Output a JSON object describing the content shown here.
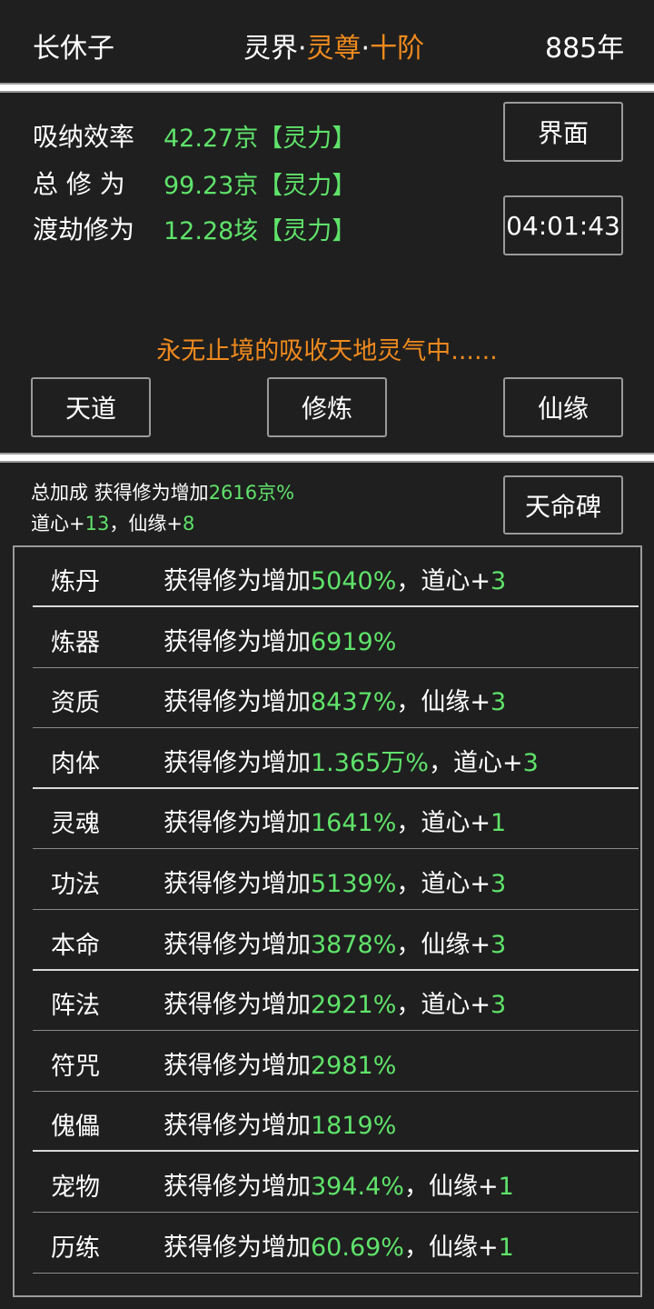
{
  "header": {
    "player_name": "长休子",
    "realm_prefix": "灵界",
    "separator": "·",
    "realm_rank": "灵尊",
    "realm_stage": "十阶",
    "year": "885年"
  },
  "stats": [
    {
      "label": "吸纳效率",
      "value": "42.27京【灵力】"
    },
    {
      "label": "总 修 为",
      "value": "99.23京【灵力】"
    },
    {
      "label": "渡劫修为",
      "value": "12.28垓【灵力】"
    }
  ],
  "buttons": {
    "interface": "界面",
    "timer": "04:01:43",
    "tiandao": "天道",
    "xiulian": "修炼",
    "xianyuan": "仙缘",
    "tianmingbei": "天命碑"
  },
  "status_message": "永无止境的吸收天地灵气中......",
  "bonus": {
    "line1_prefix": "总加成 获得修为增加",
    "line1_value": "2616京%",
    "line2_daoxin_label": "道心+",
    "line2_daoxin_value": "13",
    "line2_sep": "，仙缘+",
    "line2_xianyuan_value": "8"
  },
  "rows": [
    {
      "name": "炼丹",
      "prefix": "获得修为增加",
      "value": "5040%",
      "extra_label": "，道心+",
      "extra_value": "3"
    },
    {
      "name": "炼器",
      "prefix": "获得修为增加",
      "value": "6919%",
      "extra_label": "",
      "extra_value": ""
    },
    {
      "name": "资质",
      "prefix": "获得修为增加",
      "value": "8437%",
      "extra_label": "，仙缘+",
      "extra_value": "3"
    },
    {
      "name": "肉体",
      "prefix": "获得修为增加",
      "value": "1.365万%",
      "extra_label": "，道心+",
      "extra_value": "3"
    },
    {
      "name": "灵魂",
      "prefix": "获得修为增加",
      "value": "1641%",
      "extra_label": "，道心+",
      "extra_value": "1"
    },
    {
      "name": "功法",
      "prefix": "获得修为增加",
      "value": "5139%",
      "extra_label": "，道心+",
      "extra_value": "3"
    },
    {
      "name": "本命",
      "prefix": "获得修为增加",
      "value": "3878%",
      "extra_label": "，仙缘+",
      "extra_value": "3"
    },
    {
      "name": "阵法",
      "prefix": "获得修为增加",
      "value": "2921%",
      "extra_label": "，道心+",
      "extra_value": "3"
    },
    {
      "name": "符咒",
      "prefix": "获得修为增加",
      "value": "2981%",
      "extra_label": "",
      "extra_value": ""
    },
    {
      "name": "傀儡",
      "prefix": "获得修为增加",
      "value": "1819%",
      "extra_label": "",
      "extra_value": ""
    },
    {
      "name": "宠物",
      "prefix": "获得修为增加",
      "value": "394.4%",
      "extra_label": "，仙缘+",
      "extra_value": "1"
    },
    {
      "name": "历练",
      "prefix": "获得修为增加",
      "value": "60.69%",
      "extra_label": "，仙缘+",
      "extra_value": "1"
    }
  ]
}
